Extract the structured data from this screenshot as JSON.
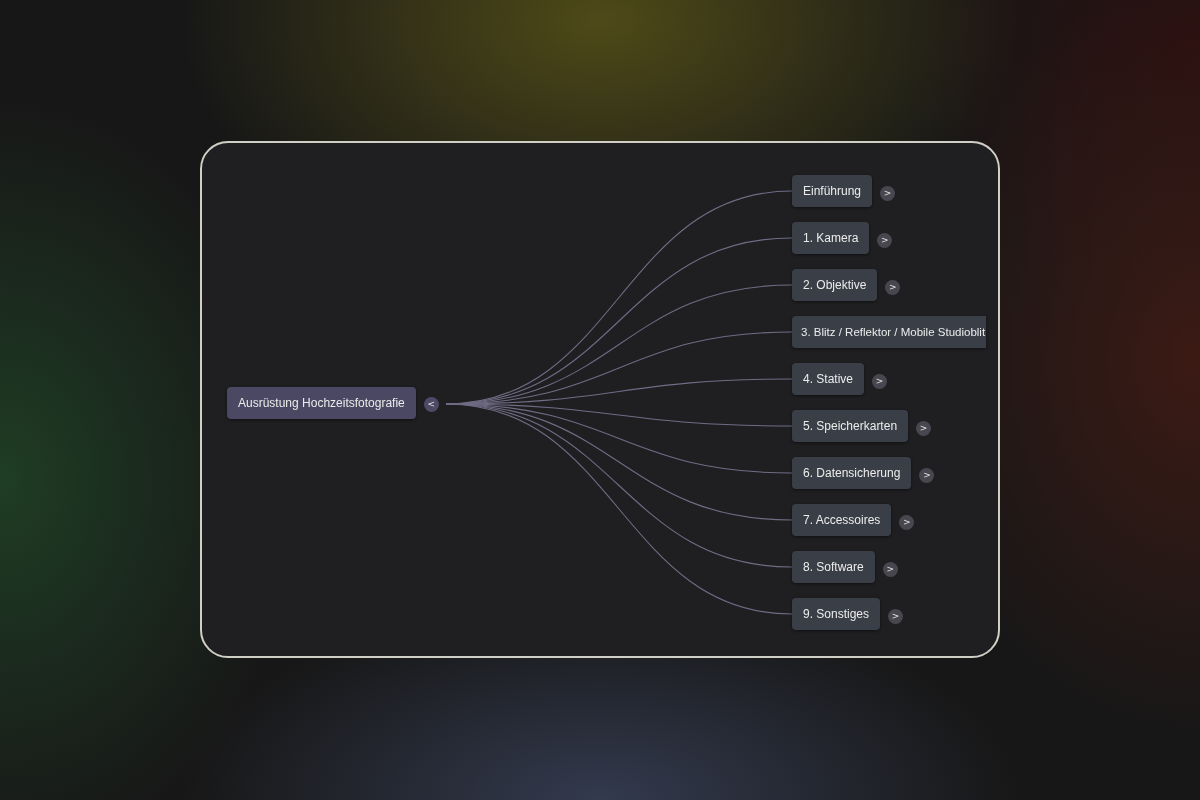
{
  "mindmap": {
    "root": {
      "label": "Ausrüstung Hochzeitsfotografie",
      "toggle": "<"
    },
    "children": [
      {
        "label": "Einführung",
        "toggle": ">"
      },
      {
        "label": "1. Kamera",
        "toggle": ">"
      },
      {
        "label": "2. Objektive",
        "toggle": ">"
      },
      {
        "label": "3. Blitz / Reflektor / Mobile Studioblit"
      },
      {
        "label": "4. Stative",
        "toggle": ">"
      },
      {
        "label": "5. Speicherkarten",
        "toggle": ">"
      },
      {
        "label": "6. Datensicherung",
        "toggle": ">"
      },
      {
        "label": "7. Accessoires",
        "toggle": ">"
      },
      {
        "label": "8. Software",
        "toggle": ">"
      },
      {
        "label": "9. Sonstiges",
        "toggle": ">"
      }
    ]
  }
}
